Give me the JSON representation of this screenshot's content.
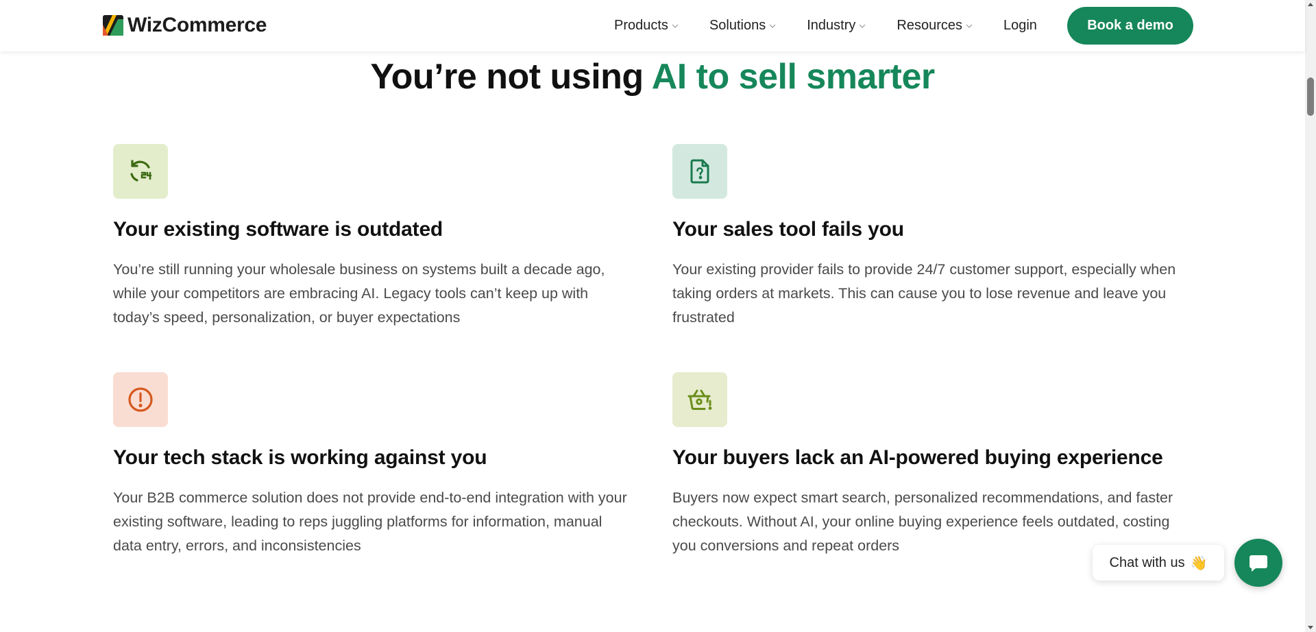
{
  "header": {
    "brand": "WizCommerce",
    "nav": [
      {
        "label": "Products",
        "has_dropdown": true
      },
      {
        "label": "Solutions",
        "has_dropdown": true
      },
      {
        "label": "Industry",
        "has_dropdown": true
      },
      {
        "label": "Resources",
        "has_dropdown": true
      }
    ],
    "login_label": "Login",
    "cta_label": "Book a demo"
  },
  "headline": {
    "prefix": "You’re not using ",
    "accent": "AI to sell smarter"
  },
  "cards": [
    {
      "icon": "refresh-24-icon",
      "title": "Your existing software is outdated",
      "body": "You’re still running your wholesale business on systems built a decade ago, while your competitors are embracing AI. Legacy tools can’t keep up with today’s speed, personalization, or buyer expectations"
    },
    {
      "icon": "file-question-icon",
      "title": "Your sales tool fails you",
      "body": "Your existing provider fails to provide 24/7 customer support, especially when taking orders at markets. This can cause you to lose revenue and leave you frustrated"
    },
    {
      "icon": "alert-circle-icon",
      "title": "Your tech stack is working against you",
      "body": "Your B2B commerce solution does not provide end-to-end integration with your existing software, leading to reps juggling platforms for information, manual data entry, errors, and inconsistencies"
    },
    {
      "icon": "basket-alert-icon",
      "title": "Your buyers lack an AI-powered buying experience",
      "body": "Buyers now expect smart search, personalized recommendations, and faster checkouts. Without AI, your online buying experience feels outdated, costing you conversions and repeat orders"
    }
  ],
  "chat": {
    "label": "Chat with us",
    "emoji": "👋"
  },
  "colors": {
    "brand_green": "#16875a",
    "icon_dark_green": "#3d6b12",
    "icon_teal": "#1a7a4e",
    "icon_orange": "#d6581e",
    "icon_olive": "#6a8d1a"
  }
}
